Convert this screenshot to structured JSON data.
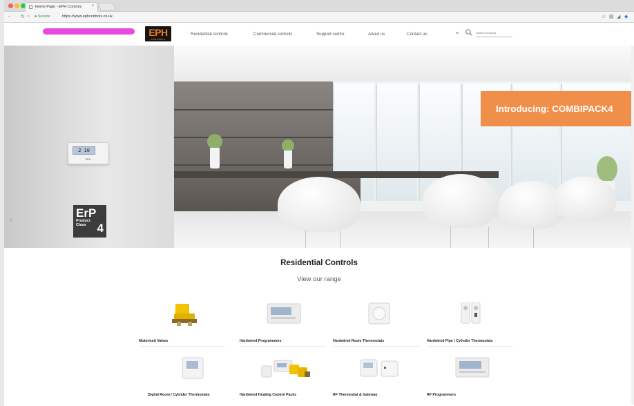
{
  "browser": {
    "tab_title": "Home Page - EPH Controls",
    "tab_close": "×",
    "secure_label": "Secure",
    "url": "https://www.ephcontrols.co.uk"
  },
  "site": {
    "logo_text": "EPH",
    "logo_subtext": "CONTROLS",
    "nav": [
      {
        "label": "Residential controls"
      },
      {
        "label": "Commercial controls"
      },
      {
        "label": "Support centre"
      },
      {
        "label": "About us"
      },
      {
        "label": "Contact us"
      }
    ],
    "nav_close": "×",
    "search_placeholder": "Search products"
  },
  "hero": {
    "banner_text": "Introducing: COMBIPACK4",
    "thermostat_display": "2 10",
    "thermostat_brand": "EPH",
    "erp_title": "ErP",
    "erp_line1": "Product",
    "erp_line2": "Class",
    "erp_number": "4",
    "prev_arrow": "‹"
  },
  "section": {
    "title": "Residential Controls",
    "subtitle": "View our range"
  },
  "products": [
    {
      "label": "Motorised Valves",
      "icon": "valve-icon"
    },
    {
      "label": "Hardwired Programmers",
      "icon": "programmer-icon"
    },
    {
      "label": "Hardwired Room Thermostats",
      "icon": "room-thermostat-icon"
    },
    {
      "label": "Hardwired Pipe / Cylinder Thermostats",
      "icon": "pipe-thermostat-icon"
    },
    {
      "label": "Digital Room / Cylinder Thermostats",
      "icon": "digital-thermostat-icon"
    },
    {
      "label": "Hardwired Heating Control Packs",
      "icon": "control-pack-icon"
    },
    {
      "label": "RF Thermostat & Gateway",
      "icon": "rf-thermostat-icon"
    },
    {
      "label": "RF Programmers",
      "icon": "rf-programmer-icon"
    }
  ],
  "colors": {
    "brand_orange": "#f07a1d",
    "banner_orange": "#f08f4a",
    "redaction": "#e64ae0"
  }
}
